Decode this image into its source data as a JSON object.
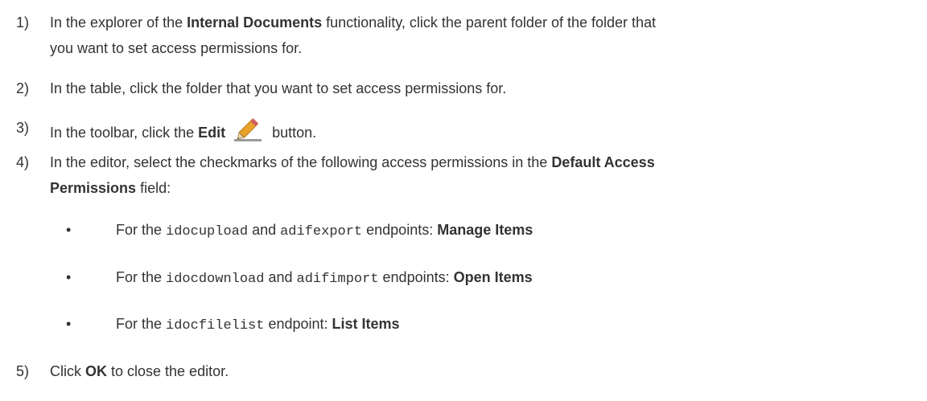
{
  "steps": [
    {
      "num": "1)",
      "line1_pre": "In the explorer of the ",
      "line1_bold": "Internal Documents",
      "line1_post": " functionality, click the parent folder of the folder that",
      "line2": "you want to set access permissions for."
    },
    {
      "num": "2)",
      "text": "In the table, click the folder that you want to set access permissions for."
    },
    {
      "num": "3)",
      "pre": "In the toolbar, click the ",
      "bold": "Edit",
      "icon": "pencil-icon",
      "post": " button."
    },
    {
      "num": "4)",
      "line1_pre": "In the editor, select the checkmarks of the following access permissions in the ",
      "line1_bold": "Default Access",
      "line2_bold": "Permissions",
      "line2_post": " field:"
    },
    {
      "num": "5)",
      "pre": "Click ",
      "bold": "OK",
      "post": " to close the editor."
    }
  ],
  "bullets": [
    {
      "dot": "•",
      "t1": "For the ",
      "c1": "idocupload",
      "t2": " and ",
      "c2": "adifexport",
      "t3": " endpoints: ",
      "bold": "Manage Items"
    },
    {
      "dot": "•",
      "t1": "For the ",
      "c1": "idocdownload",
      "t2": " and ",
      "c2": "adifimport",
      "t3": " endpoints: ",
      "bold": "Open Items"
    },
    {
      "dot": "•",
      "t1": "For the ",
      "c1": "idocfilelist",
      "t2": " endpoint: ",
      "bold": "List Items"
    }
  ],
  "colors": {
    "text": "#333333",
    "pencil_body": "#e8a32a",
    "pencil_tip": "#b0b0b0",
    "underline": "#9a9a9a"
  }
}
